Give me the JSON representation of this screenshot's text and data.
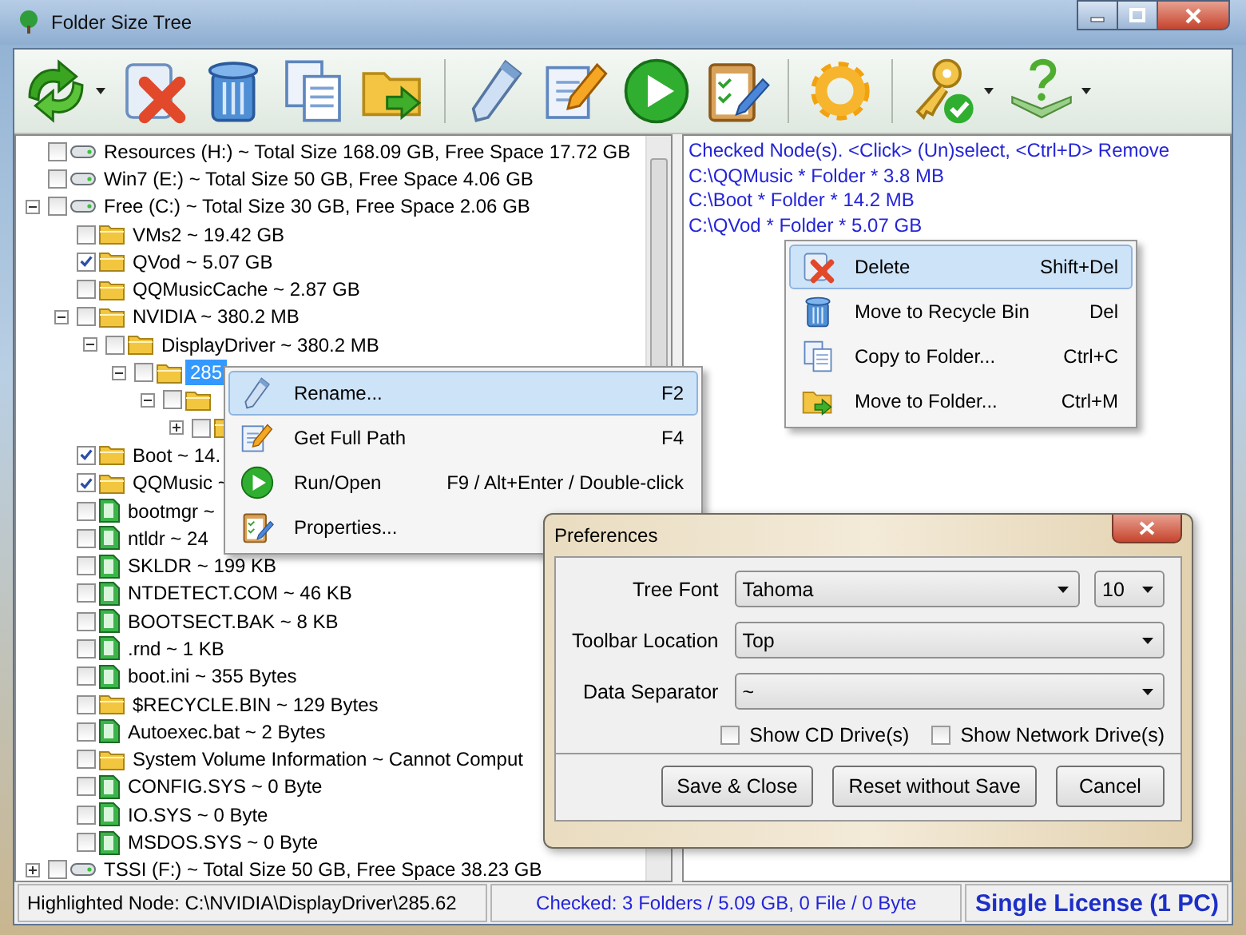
{
  "window": {
    "title": "Folder Size Tree"
  },
  "tree": [
    {
      "kind": "drive",
      "label": "Resources (H:) ~ Total Size 168.09 GB, Free Space 17.72 GB",
      "checked": false,
      "selected": false
    },
    {
      "kind": "drive",
      "label": "Win7 (E:) ~ Total Size 50 GB, Free Space 4.06 GB",
      "checked": false,
      "selected": false
    },
    {
      "kind": "drive",
      "label": "Free (C:) ~ Total Size 30 GB, Free Space 2.06 GB",
      "checked": false,
      "selected": false,
      "expanded": true,
      "children": [
        {
          "kind": "folder",
          "label": "VMs2 ~ 19.42 GB",
          "checked": false,
          "selected": false
        },
        {
          "kind": "folder",
          "label": "QVod ~ 5.07 GB",
          "checked": true,
          "selected": false
        },
        {
          "kind": "folder",
          "label": "QQMusicCache ~ 2.87 GB",
          "checked": false,
          "selected": false
        },
        {
          "kind": "folder",
          "label": "NVIDIA ~ 380.2 MB",
          "checked": false,
          "selected": false,
          "expanded": true,
          "children": [
            {
              "kind": "folder",
              "label": "DisplayDriver ~ 380.2 MB",
              "checked": false,
              "selected": false,
              "expanded": true,
              "children": [
                {
                  "kind": "folder",
                  "label": "285",
                  "checked": false,
                  "selected": true,
                  "expanded": true,
                  "children": [
                    {
                      "kind": "folder",
                      "checked": false,
                      "expanded": true,
                      "children": [
                        {
                          "kind": "folder",
                          "checked": false,
                          "expanded": false
                        }
                      ]
                    }
                  ]
                }
              ]
            }
          ]
        },
        {
          "kind": "folder",
          "label": "Boot ~ 14.",
          "checked": true,
          "selected": false
        },
        {
          "kind": "folder",
          "label": "QQMusic ~",
          "checked": true,
          "selected": false
        },
        {
          "kind": "file",
          "label": "bootmgr ~",
          "checked": false,
          "selected": false
        },
        {
          "kind": "file",
          "label": "ntldr ~ 24",
          "checked": false,
          "selected": false
        },
        {
          "kind": "file",
          "label": "SKLDR ~ 199 KB",
          "checked": false,
          "selected": false
        },
        {
          "kind": "file",
          "label": "NTDETECT.COM ~ 46 KB",
          "checked": false,
          "selected": false
        },
        {
          "kind": "file",
          "label": "BOOTSECT.BAK ~ 8 KB",
          "checked": false,
          "selected": false
        },
        {
          "kind": "file",
          "label": ".rnd ~ 1 KB",
          "checked": false,
          "selected": false
        },
        {
          "kind": "file",
          "label": "boot.ini ~ 355 Bytes",
          "checked": false,
          "selected": false
        },
        {
          "kind": "folder",
          "label": "$RECYCLE.BIN ~ 129 Bytes",
          "checked": false,
          "selected": false
        },
        {
          "kind": "file",
          "label": "Autoexec.bat ~ 2 Bytes",
          "checked": false,
          "selected": false
        },
        {
          "kind": "folder",
          "label": "System Volume Information ~ Cannot Comput",
          "checked": false,
          "selected": false
        },
        {
          "kind": "file",
          "label": "CONFIG.SYS ~ 0 Byte",
          "checked": false,
          "selected": false
        },
        {
          "kind": "file",
          "label": "IO.SYS ~ 0 Byte",
          "checked": false,
          "selected": false
        },
        {
          "kind": "file",
          "label": "MSDOS.SYS ~ 0 Byte",
          "checked": false,
          "selected": false
        }
      ]
    },
    {
      "kind": "drive",
      "label": "TSSI (F:) ~ Total Size 50 GB, Free Space 38.23 GB",
      "checked": false,
      "selected": false,
      "expanded": false
    }
  ],
  "checked_panel": {
    "lines": [
      "Checked Node(s). <Click> (Un)select, <Ctrl+D> Remove",
      "C:\\QQMusic * Folder * 3.8 MB",
      "C:\\Boot * Folder * 14.2 MB",
      "C:\\QVod * Folder * 5.07 GB"
    ]
  },
  "tree_menu": {
    "items": [
      {
        "label": "Rename...",
        "shortcut": "F2",
        "selected": true
      },
      {
        "label": "Get Full Path",
        "shortcut": "F4",
        "selected": false
      },
      {
        "label": "Run/Open",
        "shortcut": "F9 / Alt+Enter / Double-click",
        "selected": false
      },
      {
        "label": "Properties...",
        "selected": false
      }
    ]
  },
  "checked_menu": {
    "items": [
      {
        "label": "Delete",
        "shortcut": "Shift+Del",
        "selected": true
      },
      {
        "label": "Move to Recycle Bin",
        "shortcut": "Del",
        "selected": false
      },
      {
        "label": "Copy to Folder...",
        "shortcut": "Ctrl+C",
        "selected": false
      },
      {
        "label": "Move to Folder...",
        "shortcut": "Ctrl+M",
        "selected": false
      }
    ]
  },
  "preferences": {
    "title": "Preferences",
    "fields": [
      {
        "label": "Tree Font",
        "value": "Tahoma",
        "size": "10"
      },
      {
        "label": "Toolbar Location",
        "value": "Top"
      },
      {
        "label": "Data Separator",
        "value": "~"
      }
    ],
    "checkboxes": [
      {
        "label": "Show CD Drive(s)",
        "checked": false
      },
      {
        "label": "Show Network Drive(s)",
        "checked": false
      }
    ],
    "buttons": [
      "Save & Close",
      "Reset without Save",
      "Cancel"
    ]
  },
  "status_bar": {
    "highlighted": "Highlighted Node: C:\\NVIDIA\\DisplayDriver\\285.62",
    "checked": "Checked: 3 Folders / 5.09 GB, 0 File / 0 Byte",
    "license": "Single License (1 PC)"
  }
}
